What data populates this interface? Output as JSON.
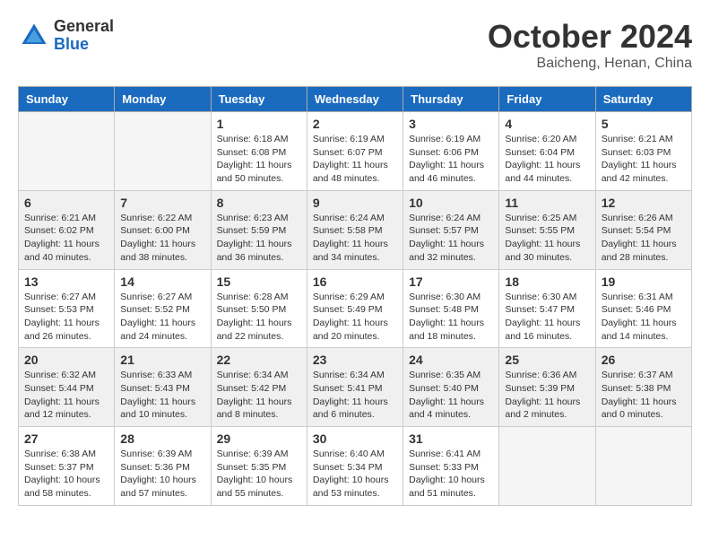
{
  "logo": {
    "general": "General",
    "blue": "Blue"
  },
  "header": {
    "month": "October 2024",
    "location": "Baicheng, Henan, China"
  },
  "weekdays": [
    "Sunday",
    "Monday",
    "Tuesday",
    "Wednesday",
    "Thursday",
    "Friday",
    "Saturday"
  ],
  "weeks": [
    [
      {
        "day": "",
        "info": ""
      },
      {
        "day": "",
        "info": ""
      },
      {
        "day": "1",
        "info": "Sunrise: 6:18 AM\nSunset: 6:08 PM\nDaylight: 11 hours\nand 50 minutes."
      },
      {
        "day": "2",
        "info": "Sunrise: 6:19 AM\nSunset: 6:07 PM\nDaylight: 11 hours\nand 48 minutes."
      },
      {
        "day": "3",
        "info": "Sunrise: 6:19 AM\nSunset: 6:06 PM\nDaylight: 11 hours\nand 46 minutes."
      },
      {
        "day": "4",
        "info": "Sunrise: 6:20 AM\nSunset: 6:04 PM\nDaylight: 11 hours\nand 44 minutes."
      },
      {
        "day": "5",
        "info": "Sunrise: 6:21 AM\nSunset: 6:03 PM\nDaylight: 11 hours\nand 42 minutes."
      }
    ],
    [
      {
        "day": "6",
        "info": "Sunrise: 6:21 AM\nSunset: 6:02 PM\nDaylight: 11 hours\nand 40 minutes."
      },
      {
        "day": "7",
        "info": "Sunrise: 6:22 AM\nSunset: 6:00 PM\nDaylight: 11 hours\nand 38 minutes."
      },
      {
        "day": "8",
        "info": "Sunrise: 6:23 AM\nSunset: 5:59 PM\nDaylight: 11 hours\nand 36 minutes."
      },
      {
        "day": "9",
        "info": "Sunrise: 6:24 AM\nSunset: 5:58 PM\nDaylight: 11 hours\nand 34 minutes."
      },
      {
        "day": "10",
        "info": "Sunrise: 6:24 AM\nSunset: 5:57 PM\nDaylight: 11 hours\nand 32 minutes."
      },
      {
        "day": "11",
        "info": "Sunrise: 6:25 AM\nSunset: 5:55 PM\nDaylight: 11 hours\nand 30 minutes."
      },
      {
        "day": "12",
        "info": "Sunrise: 6:26 AM\nSunset: 5:54 PM\nDaylight: 11 hours\nand 28 minutes."
      }
    ],
    [
      {
        "day": "13",
        "info": "Sunrise: 6:27 AM\nSunset: 5:53 PM\nDaylight: 11 hours\nand 26 minutes."
      },
      {
        "day": "14",
        "info": "Sunrise: 6:27 AM\nSunset: 5:52 PM\nDaylight: 11 hours\nand 24 minutes."
      },
      {
        "day": "15",
        "info": "Sunrise: 6:28 AM\nSunset: 5:50 PM\nDaylight: 11 hours\nand 22 minutes."
      },
      {
        "day": "16",
        "info": "Sunrise: 6:29 AM\nSunset: 5:49 PM\nDaylight: 11 hours\nand 20 minutes."
      },
      {
        "day": "17",
        "info": "Sunrise: 6:30 AM\nSunset: 5:48 PM\nDaylight: 11 hours\nand 18 minutes."
      },
      {
        "day": "18",
        "info": "Sunrise: 6:30 AM\nSunset: 5:47 PM\nDaylight: 11 hours\nand 16 minutes."
      },
      {
        "day": "19",
        "info": "Sunrise: 6:31 AM\nSunset: 5:46 PM\nDaylight: 11 hours\nand 14 minutes."
      }
    ],
    [
      {
        "day": "20",
        "info": "Sunrise: 6:32 AM\nSunset: 5:44 PM\nDaylight: 11 hours\nand 12 minutes."
      },
      {
        "day": "21",
        "info": "Sunrise: 6:33 AM\nSunset: 5:43 PM\nDaylight: 11 hours\nand 10 minutes."
      },
      {
        "day": "22",
        "info": "Sunrise: 6:34 AM\nSunset: 5:42 PM\nDaylight: 11 hours\nand 8 minutes."
      },
      {
        "day": "23",
        "info": "Sunrise: 6:34 AM\nSunset: 5:41 PM\nDaylight: 11 hours\nand 6 minutes."
      },
      {
        "day": "24",
        "info": "Sunrise: 6:35 AM\nSunset: 5:40 PM\nDaylight: 11 hours\nand 4 minutes."
      },
      {
        "day": "25",
        "info": "Sunrise: 6:36 AM\nSunset: 5:39 PM\nDaylight: 11 hours\nand 2 minutes."
      },
      {
        "day": "26",
        "info": "Sunrise: 6:37 AM\nSunset: 5:38 PM\nDaylight: 11 hours\nand 0 minutes."
      }
    ],
    [
      {
        "day": "27",
        "info": "Sunrise: 6:38 AM\nSunset: 5:37 PM\nDaylight: 10 hours\nand 58 minutes."
      },
      {
        "day": "28",
        "info": "Sunrise: 6:39 AM\nSunset: 5:36 PM\nDaylight: 10 hours\nand 57 minutes."
      },
      {
        "day": "29",
        "info": "Sunrise: 6:39 AM\nSunset: 5:35 PM\nDaylight: 10 hours\nand 55 minutes."
      },
      {
        "day": "30",
        "info": "Sunrise: 6:40 AM\nSunset: 5:34 PM\nDaylight: 10 hours\nand 53 minutes."
      },
      {
        "day": "31",
        "info": "Sunrise: 6:41 AM\nSunset: 5:33 PM\nDaylight: 10 hours\nand 51 minutes."
      },
      {
        "day": "",
        "info": ""
      },
      {
        "day": "",
        "info": ""
      }
    ]
  ]
}
